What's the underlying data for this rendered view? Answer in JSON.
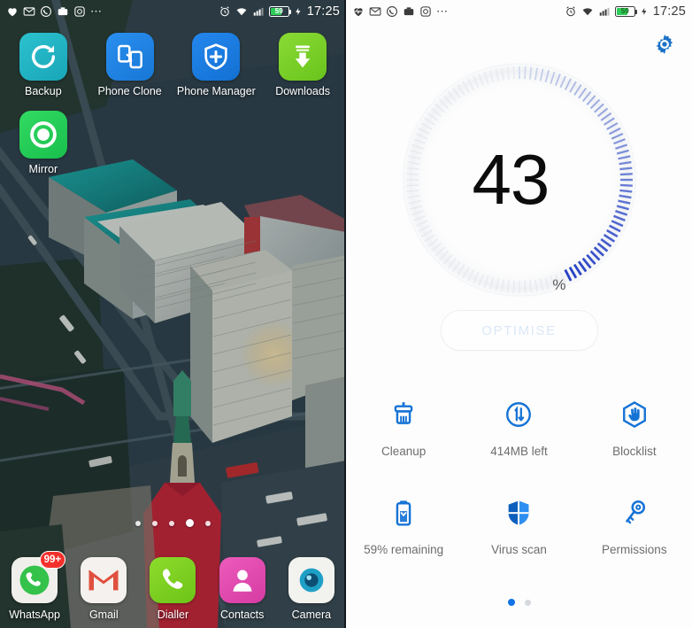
{
  "status_bar": {
    "notification_icons": [
      "heart-icon",
      "gmail-icon",
      "whatsapp-icon",
      "screenshot-icon",
      "instagram-icon"
    ],
    "overflow": "⋯",
    "system_icons": [
      "alarm-icon",
      "wifi-icon",
      "signal-icon"
    ],
    "battery_level": "59",
    "charging": true,
    "time": "17:25"
  },
  "home_screen": {
    "app_rows": [
      [
        {
          "label": "Backup",
          "icon": "backup-icon",
          "color": "#23b2c4"
        },
        {
          "label": "Phone Clone",
          "icon": "phone-clone-icon",
          "color": "#1f87e8"
        },
        {
          "label": "Phone Manager",
          "icon": "phone-manager-icon",
          "color": "#1a7ce0"
        },
        {
          "label": "Downloads",
          "icon": "downloads-icon",
          "color": "#7bd12a"
        }
      ],
      [
        {
          "label": "Mirror",
          "icon": "mirror-icon",
          "color": "#27cf5b"
        }
      ]
    ],
    "page_dots": {
      "count": 5,
      "active_index": 3
    },
    "dock": [
      {
        "label": "WhatsApp",
        "icon": "whatsapp-icon",
        "color": "#f2f2f0",
        "badge": "99+"
      },
      {
        "label": "Gmail",
        "icon": "gmail-icon",
        "color": "#f4f2ef",
        "badge": ""
      },
      {
        "label": "Dialler",
        "icon": "dialler-icon",
        "color": "#7ed321",
        "badge": ""
      },
      {
        "label": "Contacts",
        "icon": "contacts-icon",
        "color": "#e04bb0",
        "badge": ""
      },
      {
        "label": "Camera",
        "icon": "camera-icon",
        "color": "#f3f3f1",
        "badge": ""
      }
    ]
  },
  "phone_manager": {
    "settings_icon": "gear-icon",
    "gauge": {
      "value": "43",
      "unit": "%",
      "max": 100,
      "accent_color": "#2440c4",
      "track_color": "#e6e9ee"
    },
    "optimise_button": {
      "label": "OPTIMISE",
      "text_color": "#dbe7f5"
    },
    "tiles": [
      [
        {
          "label": "Cleanup",
          "icon": "brush-icon"
        },
        {
          "label": "414MB left",
          "icon": "data-usage-icon"
        },
        {
          "label": "Blocklist",
          "icon": "blocklist-hand-icon"
        }
      ],
      [
        {
          "label": "59% remaining",
          "icon": "battery-icon"
        },
        {
          "label": "Virus scan",
          "icon": "shield-icon"
        },
        {
          "label": "Permissions",
          "icon": "key-icon"
        }
      ]
    ],
    "page_dots": {
      "count": 2,
      "active_index": 0
    },
    "icon_color": "#1673d6",
    "label_color": "#6d6d6d"
  }
}
